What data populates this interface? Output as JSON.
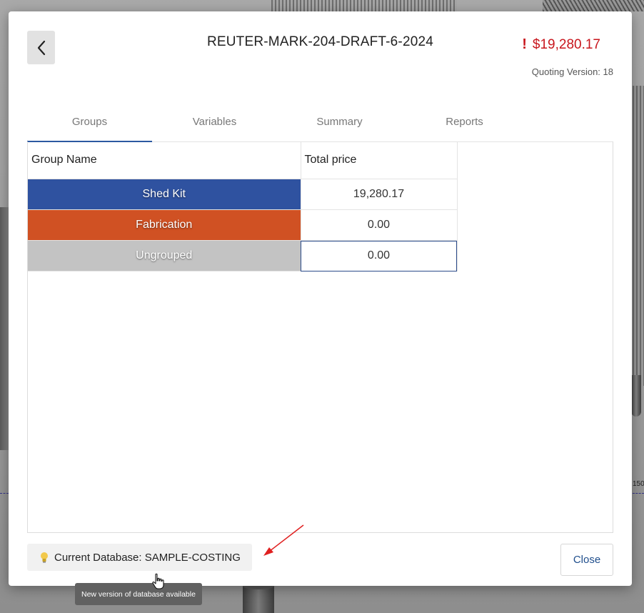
{
  "header": {
    "title": "REUTER-MARK-204-DRAFT-6-2024",
    "price_alert": "!",
    "price": "$19,280.17",
    "quoting_version": "Quoting Version: 18"
  },
  "tabs": [
    {
      "label": "Groups",
      "active": true
    },
    {
      "label": "Variables",
      "active": false
    },
    {
      "label": "Summary",
      "active": false
    },
    {
      "label": "Reports",
      "active": false
    }
  ],
  "table": {
    "columns": [
      "Group Name",
      "Total price"
    ],
    "rows": [
      {
        "name": "Shed Kit",
        "total": "19,280.17",
        "color": "#2f52a0"
      },
      {
        "name": "Fabrication",
        "total": "0.00",
        "color": "#d05123"
      },
      {
        "name": "Ungrouped",
        "total": "0.00",
        "color": "#c3c3c3"
      }
    ]
  },
  "footer": {
    "database_icon": "lightbulb-icon",
    "database_label": "Current Database: SAMPLE-COSTING",
    "tooltip": "New version of database available",
    "close_label": "Close"
  },
  "background": {
    "dimension_label": "150"
  },
  "colors": {
    "accent": "#2b58a0",
    "price_red": "#c8161d",
    "annotation_arrow": "#e02020"
  }
}
